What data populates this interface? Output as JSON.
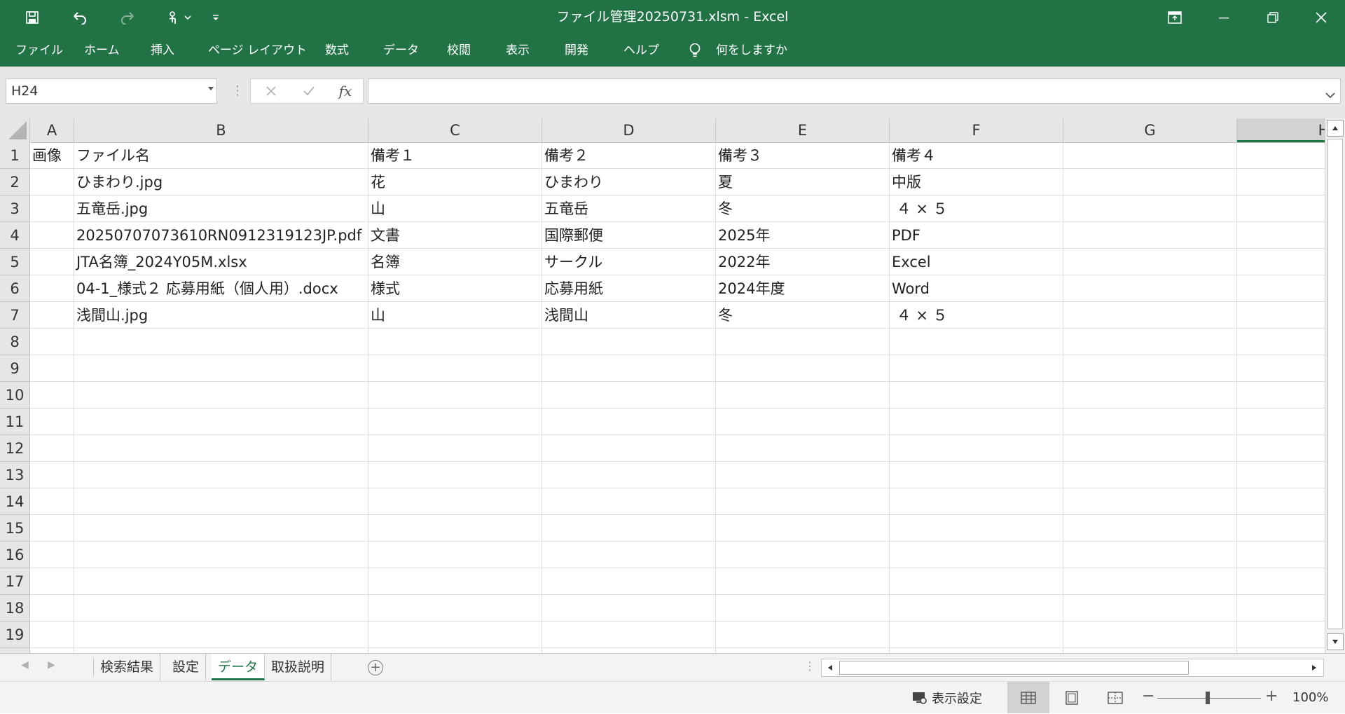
{
  "window": {
    "title": "ファイル管理20250731.xlsm  -  Excel",
    "accent_color": "#217346"
  },
  "quick_access": {
    "icons": [
      "save-icon",
      "undo-icon",
      "redo-icon",
      "touch-mode-icon",
      "customize-qat-icon"
    ]
  },
  "menu": {
    "items": [
      "ファイル",
      "ホーム",
      "挿入",
      "ページ レイアウト",
      "数式",
      "データ",
      "校閲",
      "表示",
      "開発",
      "ヘルプ"
    ],
    "tell_me": "何をしますか"
  },
  "formula_bar": {
    "name_box": "H24",
    "fx_label": "fx",
    "value": ""
  },
  "sheet": {
    "columns": [
      "A",
      "B",
      "C",
      "D",
      "E",
      "F",
      "G",
      "H"
    ],
    "selected_column": "H",
    "row_numbers": [
      "1",
      "2",
      "3",
      "4",
      "5",
      "6",
      "7",
      "8",
      "9",
      "10",
      "11",
      "12",
      "13",
      "14",
      "15",
      "16",
      "17",
      "18",
      "19"
    ],
    "rows": [
      [
        "画像",
        "ファイル名",
        "備考１",
        "備考２",
        "備考３",
        "備考４"
      ],
      [
        "",
        "ひまわり.jpg",
        "花",
        "ひまわり",
        "夏",
        "中版"
      ],
      [
        "",
        "五竜岳.jpg",
        "山",
        "五竜岳",
        "冬",
        " ４ × ５"
      ],
      [
        "",
        "20250707073610RN0912319123JP.pdf",
        "文書",
        "国際郵便",
        "2025年",
        "PDF"
      ],
      [
        "",
        "JTA名簿_2024Y05M.xlsx",
        "名簿",
        "サークル",
        "2022年",
        "Excel"
      ],
      [
        "",
        "04-1_様式２ 応募用紙（個人用）.docx",
        "様式",
        "応募用紙",
        "2024年度",
        "Word"
      ],
      [
        "",
        "浅間山.jpg",
        "山",
        "浅間山",
        "冬",
        " ４ × ５"
      ]
    ]
  },
  "tabs": {
    "sheets": [
      "検索結果",
      "設定",
      "データ",
      "取扱説明"
    ],
    "active": "データ"
  },
  "status": {
    "display_settings": "表示設定",
    "zoom": "100%"
  }
}
